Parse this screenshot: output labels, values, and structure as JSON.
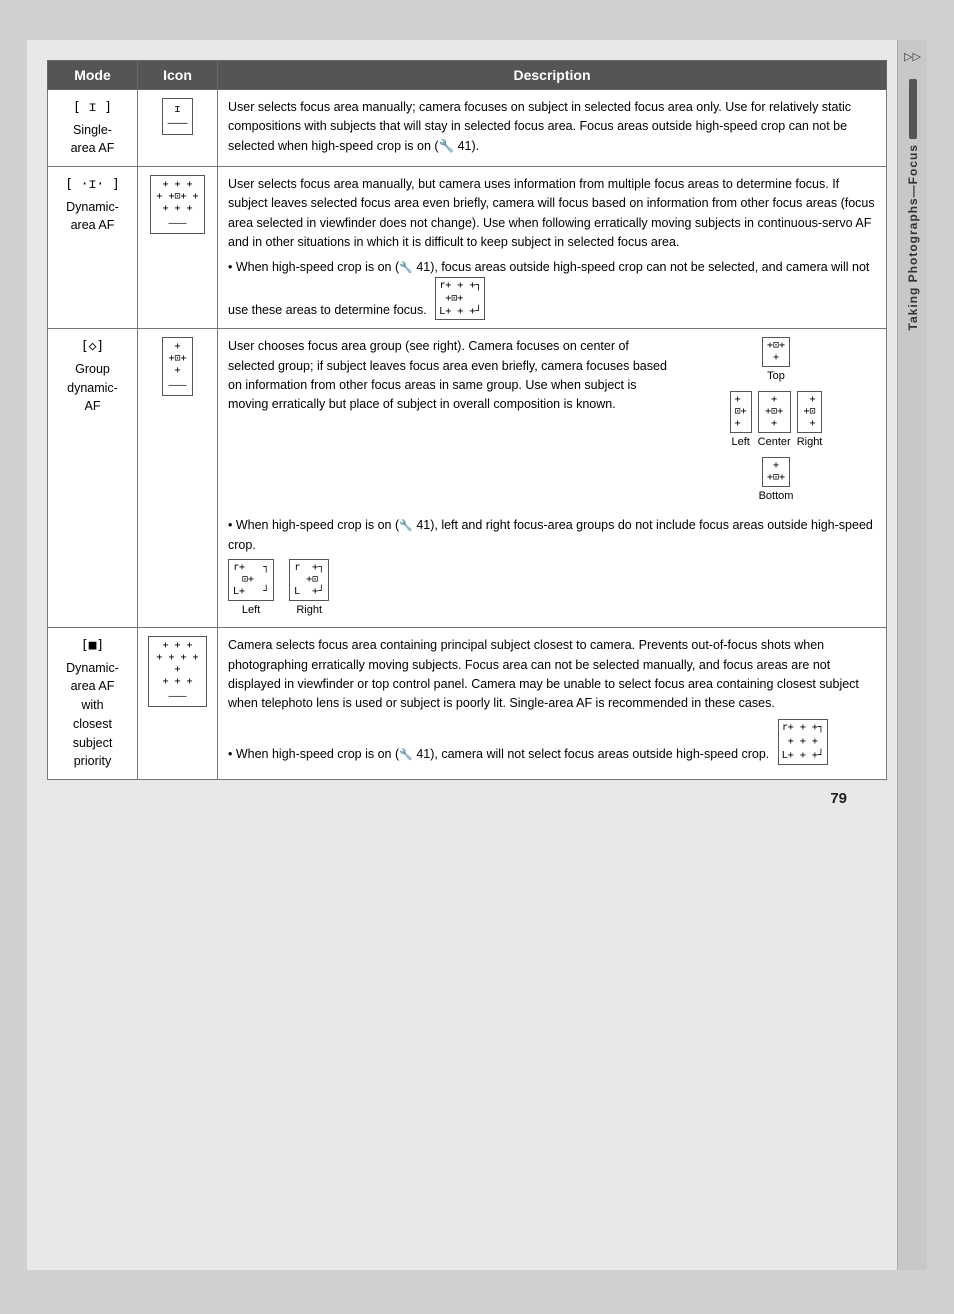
{
  "page": {
    "number": "79",
    "side_tab": {
      "icon": "▷▷",
      "label": "Taking Photographs—Focus"
    }
  },
  "table": {
    "headers": [
      "Mode",
      "Icon",
      "Description"
    ],
    "rows": [
      {
        "mode_symbol": "[ ɪ ]",
        "mode_label": "Single-\narea AF",
        "icon_content": "[ ɪ ]",
        "description_main": "User selects focus area manually; camera focuses on subject in selected focus area only.  Use for relatively static compositions with subjects that will stay in selected focus area.  Focus areas outside high-speed crop can not be selected when high-speed crop is on (🔧 41).",
        "has_note": false
      },
      {
        "mode_symbol": "[ ·ɪ· ]",
        "mode_label": "Dynamic-\narea AF",
        "icon_content_lines": [
          "+ + +",
          "+ +⊡+ +",
          "+ + +"
        ],
        "description_main": "User selects focus area manually, but camera uses information from multiple focus areas to determine focus.  If subject leaves selected focus area even briefly, camera will focus based on information from other focus areas (focus area selected in viewfinder does not change).  Use when following erratically moving subjects in continuous-servo AF and in other situations in which it is difficult to keep subject in selected focus area.",
        "note_text": "• When high-speed crop is on (🔧 41), focus areas outside high-speed crop can not be selected, and camera will not use these areas to determine focus.",
        "has_note": true,
        "note_icon_lines": [
          "r+ + +┐",
          " +⊡+",
          "L+ + +┘"
        ]
      },
      {
        "mode_symbol": "[◇]",
        "mode_label": "Group\ndynamic-\nAF",
        "icon_content_lines": [
          "  +  ",
          "+⊡+",
          "  +  "
        ],
        "description_left": "User chooses focus area group (see right).  Camera focuses on center of selected group; if subject leaves focus area even briefly, camera focuses based on information from other focus areas in same group.  Use when subject is moving erratically but place of subject in overall composition is known.",
        "diagram_top_lines": [
          " +⊡+",
          "  +  "
        ],
        "diagram_top_label": "Top",
        "diagram_left_lines": [
          " +  ",
          "+⊡+",
          " +  "
        ],
        "diagram_left_label": "Left",
        "diagram_center_lines": [
          "  +  ",
          "+⊡+",
          "  +  "
        ],
        "diagram_center_label": "Center",
        "diagram_right_lines": [
          "  +  ",
          "+⊡+",
          "  +  "
        ],
        "diagram_right_label": "Right",
        "diagram_bottom_lines": [
          " +  ",
          "+⊡+",
          " +  "
        ],
        "diagram_bottom_label": "Bottom",
        "note_text": "• When high-speed crop is on (🔧 41), left and right focus-area groups do not include focus areas outside high-speed crop.",
        "note_left_label": "Left",
        "note_right_label": "Right"
      },
      {
        "mode_symbol": "[■]",
        "mode_label": "Dynamic-\narea AF\nwith\nclosest\nsubject\npriority",
        "icon_content_lines": [
          "+ + +",
          "+ + + + +",
          "+ + +"
        ],
        "description_main": "Camera selects focus area containing principal subject closest to camera.  Prevents out-of-focus shots when photographing erratically moving subjects.  Focus area can not be selected manually, and focus areas are not displayed in viewfinder or top control panel.  Camera may be unable to select focus area containing closest subject when telephoto lens is used or subject is poorly lit.  Single-area AF is recommended in these cases.",
        "note_text": "• When high-speed crop is on (🔧 41), camera will not select focus areas outside high-speed crop.",
        "note_icon_lines": [
          "r+ + +┐",
          " + + +",
          "L+ + +┘"
        ]
      }
    ]
  }
}
